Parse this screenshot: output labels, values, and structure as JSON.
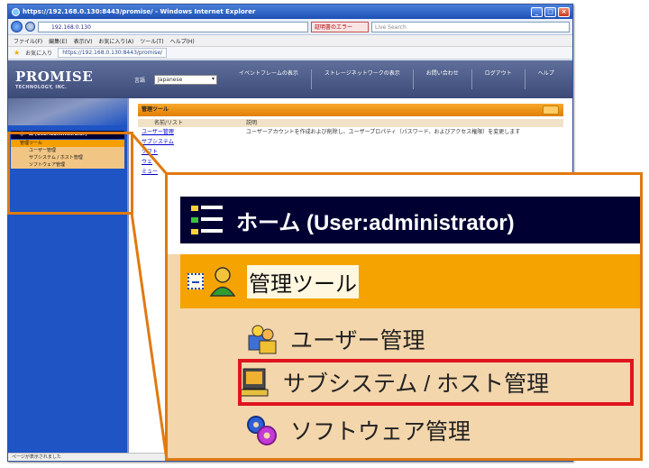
{
  "browser": {
    "title": "https://192.168.0.130:8443/promise/ - Windows Internet Explorer",
    "address": "192.168.0.130",
    "cert_error": "証明書のエラー",
    "search_placeholder": "Live Search",
    "menu": [
      "ファイル(F)",
      "編集(E)",
      "表示(V)",
      "お気に入り(A)",
      "ツール(T)",
      "ヘルプ(H)"
    ],
    "favorites_label": "お気に入り",
    "tab_label": "https://192.168.0.130:8443/promise/"
  },
  "app": {
    "brand": "PROMISE",
    "brand_sub": "TECHNOLOGY, INC.",
    "language_label": "言語",
    "language_value": "Japanese",
    "nav": [
      "イベントフレームの表示",
      "ストレージネットワークの表示",
      "お問い合わせ",
      "ログアウト",
      "ヘルプ"
    ],
    "tree_title": "ホーム (User:administrator)",
    "tree_items": [
      "管理ツール",
      "ユーザー管理",
      "サブシステム / ホスト管理",
      "ソフトウェア管理"
    ],
    "main_title": "管理ツール",
    "table_headers": [
      "名前/リスト",
      "説明"
    ],
    "table_rows": [
      {
        "name": "ユーザー管理",
        "desc": "ユーザーアカウントを作成および削除し、ユーザープロパティ（パスワード、およびアクセス権限）を変更します"
      },
      {
        "name": "サブシステム",
        "desc": ""
      },
      {
        "name": "ソフト",
        "desc": ""
      },
      {
        "name": "ウェ",
        "desc": ""
      },
      {
        "name": "ミュー",
        "desc": ""
      }
    ],
    "status": "ページが表示されました"
  },
  "zoom": {
    "title": "ホーム (User:administrator)",
    "selected": "管理ツール",
    "items": [
      "ユーザー管理",
      "サブシステム / ホスト管理",
      "ソフトウェア管理"
    ]
  },
  "colors": {
    "callout": "#e07a10",
    "highlight": "#e0141e",
    "selection": "#f5a300",
    "nav_blue": "#1e54c4"
  }
}
